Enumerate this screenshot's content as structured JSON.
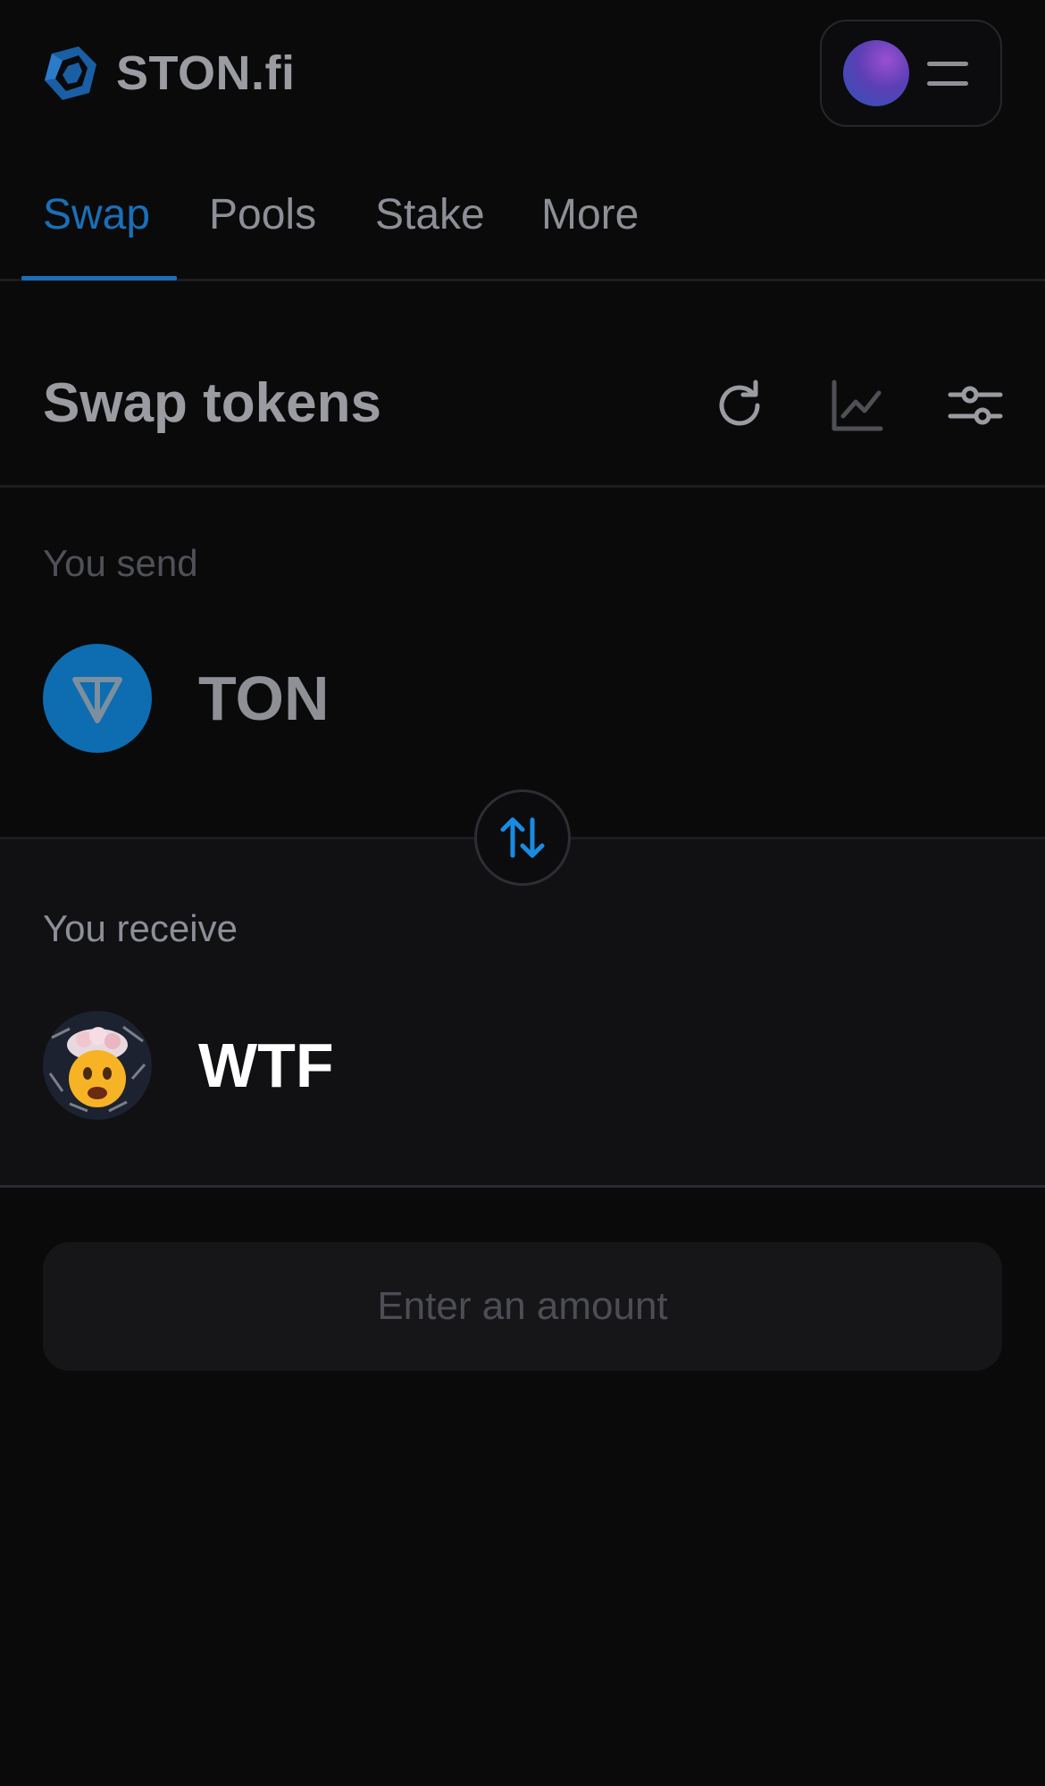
{
  "header": {
    "brand": "STON.fi",
    "brand_color": "#1a5fa3"
  },
  "tabs": [
    {
      "label": "Swap",
      "active": true
    },
    {
      "label": "Pools",
      "active": false
    },
    {
      "label": "Stake",
      "active": false
    },
    {
      "label": "More",
      "active": false
    }
  ],
  "swap": {
    "title": "Swap tokens",
    "icons": [
      "refresh-icon",
      "chart-icon",
      "settings-sliders-icon"
    ],
    "send": {
      "label": "You send",
      "token": "TON",
      "token_color": "#0e6cb0"
    },
    "receive": {
      "label": "You receive",
      "token": "WTF"
    },
    "switch_icon": "swap-arrows-icon",
    "cta": "Enter an amount"
  },
  "colors": {
    "accent": "#1a6fb8",
    "background": "#0a0a0b",
    "panel": "#111114"
  }
}
